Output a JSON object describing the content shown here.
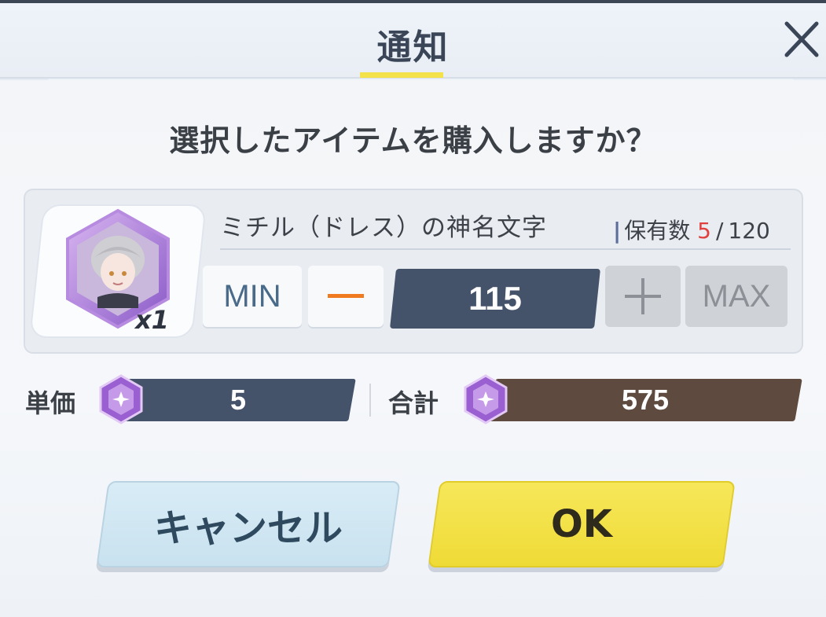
{
  "dialog": {
    "title": "通知",
    "question": "選択したアイテムを購入しますか？"
  },
  "item": {
    "name": "ミチル（ドレス）の神名文字",
    "multiplier": "x1",
    "owned_label": "保有数",
    "owned_current": "5",
    "owned_max": "120",
    "owned_slash": "/"
  },
  "quantity": {
    "min_label": "MIN",
    "max_label": "MAX",
    "value": "115"
  },
  "price": {
    "unit_label": "単価",
    "unit_value": "5",
    "total_label": "合計",
    "total_value": "575"
  },
  "actions": {
    "cancel_label": "キャンセル",
    "ok_label": "OK"
  },
  "colors": {
    "accent_yellow": "#f3e24a",
    "qty_bg": "#44526a",
    "total_bg": "#5e4a3f",
    "owned_current": "#e2403f",
    "minus_orange": "#f07a1f"
  },
  "icons": [
    "close-icon",
    "minus-icon",
    "plus-icon",
    "gem-icon",
    "character-portrait"
  ]
}
